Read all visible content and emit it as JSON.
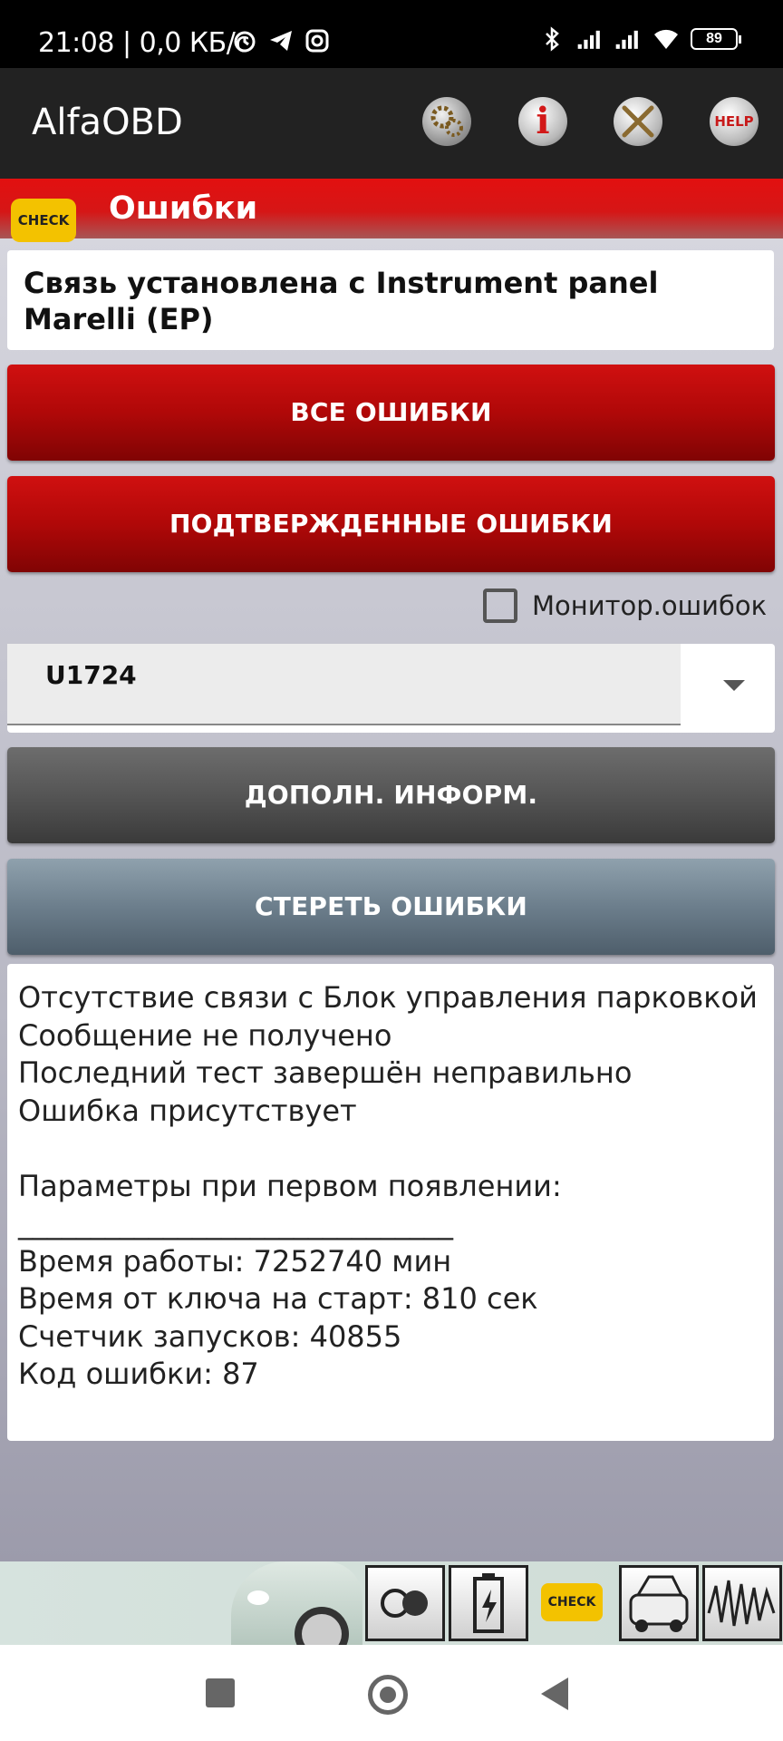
{
  "status_bar": {
    "time": "21:08 | 0,0 КБ/с",
    "battery": "89",
    "icons": [
      "alarm-icon",
      "telegram-icon",
      "instagram-icon",
      "bluetooth-icon",
      "signal-icon",
      "signal-icon",
      "wifi-icon",
      "battery-icon"
    ]
  },
  "app_bar": {
    "title": "AlfaOBD",
    "info_glyph": "i",
    "help_label": "HELP",
    "icons": [
      "gears-icon",
      "info-icon",
      "tools-icon",
      "help-icon"
    ]
  },
  "section": {
    "badge": "CHECK",
    "title": "Ошибки"
  },
  "connection": {
    "text": "Связь установлена с Instrument panel Marelli (EP)"
  },
  "buttons": {
    "all_errors": "ВСЕ ОШИБКИ",
    "confirmed_errors": "ПОДТВЕРЖДЕННЫЕ ОШИБКИ",
    "more_info": "ДОПОЛН. ИНФОРМ.",
    "clear_errors": "СТЕРЕТЬ ОШИБКИ"
  },
  "monitor": {
    "label": "Монитор.ошибок",
    "checked": false
  },
  "dtc_select": {
    "value": "U1724"
  },
  "details": {
    "lines": [
      "Отсутствие связи с Блок управления парковкой",
      "Сообщение не получено",
      "Последний тест завершён неправильно",
      "Ошибка присутствует",
      "",
      "Параметры при первом появлении:",
      "______________________________",
      "Время работы: 7252740 мин",
      "Время от ключа на старт: 810 сек",
      "Счетчик запусков: 40855",
      "Код ошибки: 87"
    ]
  },
  "bottom_strip": {
    "check_label": "CHECK",
    "icons": [
      "car-icon",
      "speaker-icon",
      "battery-charge-icon",
      "check-engine-icon",
      "car-hood-icon",
      "oscilloscope-icon"
    ]
  },
  "colors": {
    "header_red": "#e21010",
    "button_red": "#b00808",
    "button_gray": "#555555",
    "button_slate": "#6c7e8c",
    "check_yellow": "#f3c200"
  }
}
